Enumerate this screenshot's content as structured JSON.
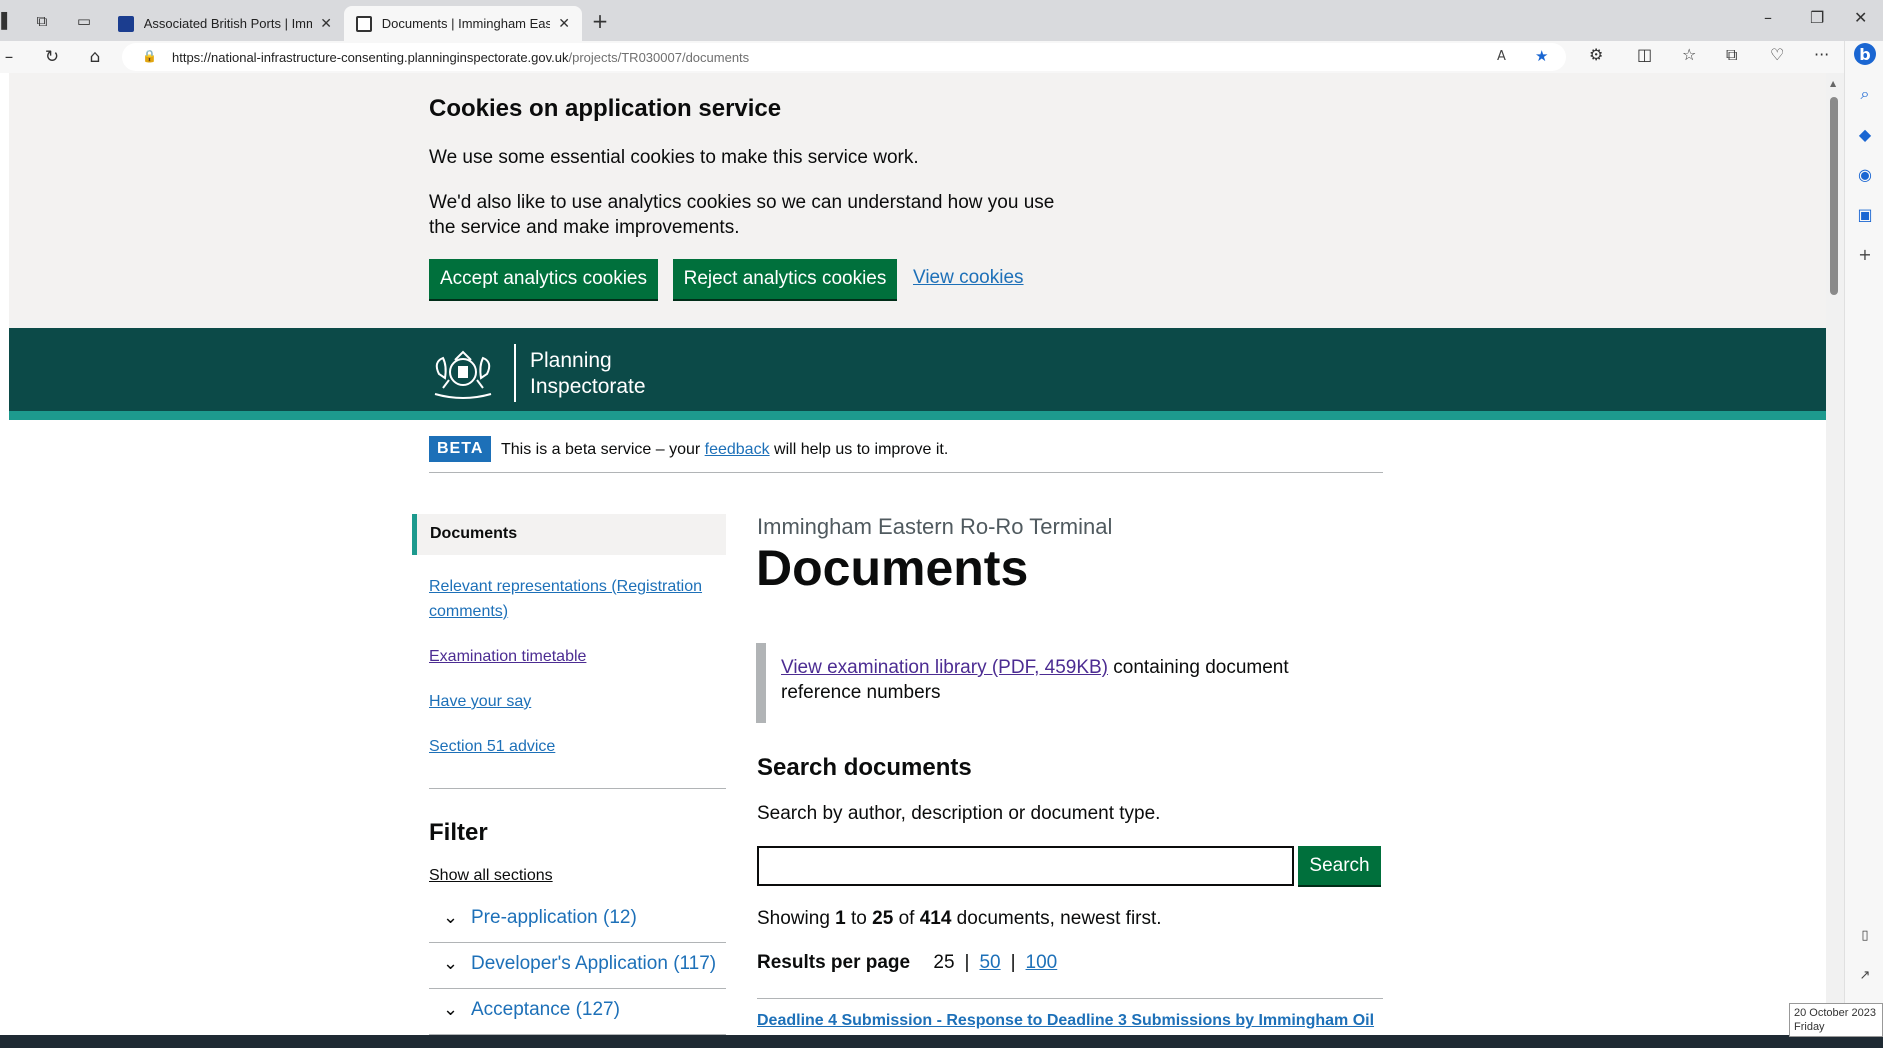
{
  "browser": {
    "tabs": [
      {
        "title": "Associated British Ports | Imming",
        "active": false
      },
      {
        "title": "Documents | Immingham Eastern",
        "active": true
      }
    ],
    "url_host": "https://national-infrastructure-consenting.planninginspectorate.gov.uk",
    "url_path": "/projects/TR030007/documents",
    "new_tab": "+"
  },
  "cookie_banner": {
    "title": "Cookies on application service",
    "p1": "We use some essential cookies to make this service work.",
    "p2": "We'd also like to use analytics cookies so we can understand how you use the service and make improvements.",
    "accept": "Accept analytics cookies",
    "reject": "Reject analytics cookies",
    "view": "View cookies"
  },
  "header": {
    "brand_line1": "Planning",
    "brand_line2": "Inspectorate"
  },
  "beta": {
    "tag": "BETA",
    "text_before": "This is a beta service – your ",
    "link": "feedback",
    "text_after": " will help us to improve it."
  },
  "sidenav": {
    "active": "Documents",
    "links": [
      "Relevant representations (Registration comments)",
      "Examination timetable",
      "Have your say",
      "Section 51 advice"
    ]
  },
  "filter": {
    "title": "Filter",
    "show_all": "Show all sections",
    "sections": [
      "Pre-application (12)",
      "Developer's Application (117)",
      "Acceptance (127)"
    ]
  },
  "main": {
    "caption": "Immingham Eastern Ro-Ro Terminal",
    "title": "Documents",
    "inset_link": "View examination library (PDF, 459KB)",
    "inset_text": " containing document reference numbers",
    "search_title": "Search documents",
    "search_hint": "Search by author, description or document type.",
    "search_value": "",
    "search_button": "Search",
    "showing_prefix": "Showing ",
    "showing_from": "1",
    "showing_to_word": " to ",
    "showing_to": "25",
    "showing_of_word": " of ",
    "showing_total": "414",
    "showing_suffix": " documents, newest first.",
    "rpp_label": "Results per page",
    "rpp_current": "25",
    "rpp_options": [
      "50",
      "100"
    ],
    "first_doc": "Deadline 4 Submission - Response to Deadline 3 Submissions by Immingham Oil"
  },
  "system": {
    "date": "20 October 2023",
    "day": "Friday"
  }
}
